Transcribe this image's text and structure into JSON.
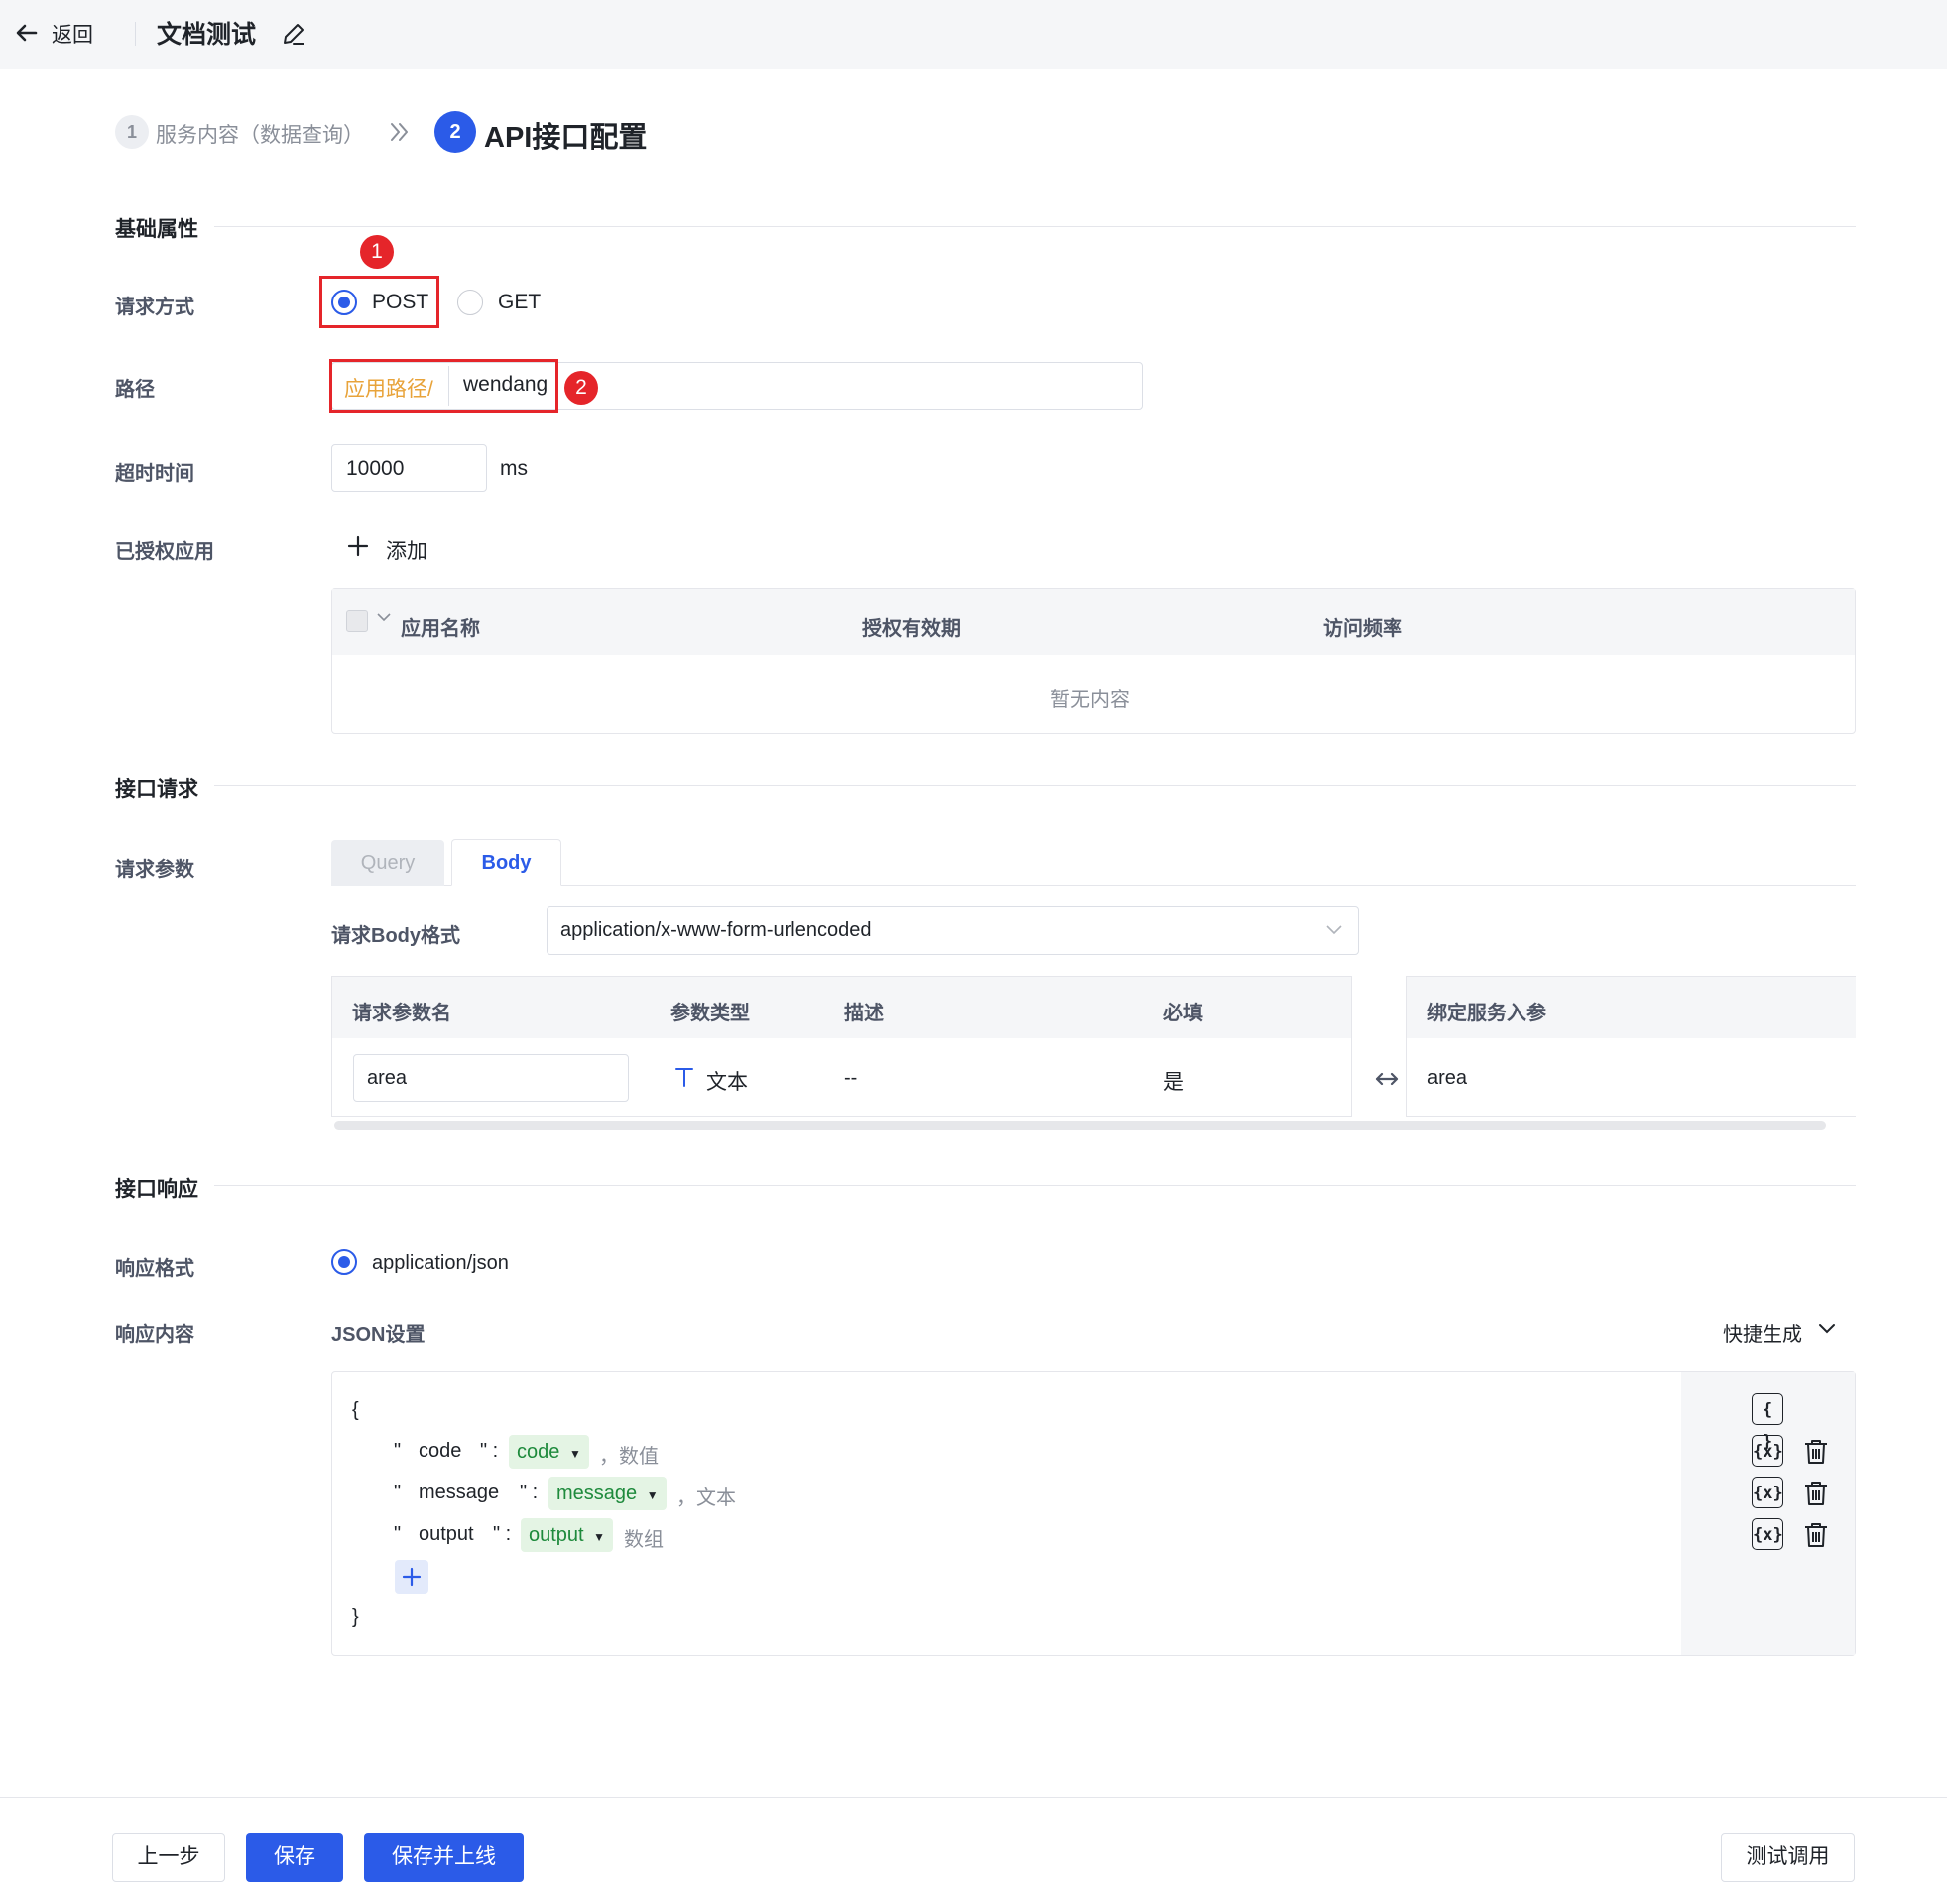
{
  "topbar": {
    "back_label": "返回",
    "title": "文档测试"
  },
  "steps": [
    {
      "number": "1",
      "label": "服务内容（数据查询）"
    },
    {
      "number": "2",
      "label": "API接口配置"
    }
  ],
  "basic": {
    "section_title": "基础属性",
    "method_label": "请求方式",
    "methods": [
      "POST",
      "GET"
    ],
    "selected_method": "POST",
    "badge1": "1",
    "path_label": "路径",
    "path_prefix": "应用路径/",
    "path_value": "wendang",
    "badge2": "2",
    "timeout_label": "超时时间",
    "timeout_value": "10000",
    "timeout_unit": "ms",
    "auth_label": "已授权应用",
    "add_label": "添加",
    "auth_table": {
      "columns": [
        "应用名称",
        "授权有效期",
        "访问频率"
      ],
      "empty_text": "暂无内容"
    }
  },
  "request": {
    "section_title": "接口请求",
    "params_label": "请求参数",
    "tabs": [
      "Query",
      "Body"
    ],
    "active_tab": "Body",
    "body_format_label": "请求Body格式",
    "body_format_value": "application/x-www-form-urlencoded",
    "params_table": {
      "columns": [
        "请求参数名",
        "参数类型",
        "描述",
        "必填"
      ],
      "bind_column": "绑定服务入参",
      "rows": [
        {
          "name": "area",
          "type": "文本",
          "desc": "--",
          "required": "是",
          "bind": "area"
        }
      ]
    }
  },
  "response": {
    "section_title": "接口响应",
    "format_label": "响应格式",
    "format_value": "application/json",
    "content_label": "响应内容",
    "json_settings_label": "JSON设置",
    "quick_generate_label": "快捷生成",
    "json_open": "{",
    "json_close": "}",
    "json_fields": [
      {
        "key": "code",
        "value": "code",
        "type": "数值",
        "sep": "，"
      },
      {
        "key": "message",
        "value": "message",
        "type": "文本",
        "sep": "，"
      },
      {
        "key": "output",
        "value": "output",
        "type": "数组",
        "sep": ""
      }
    ],
    "tool_obj": "{ }",
    "tool_var": "{x}"
  },
  "footer": {
    "prev_label": "上一步",
    "save_label": "保存",
    "save_online_label": "保存并上线",
    "test_label": "测试调用"
  },
  "colors": {
    "primary": "#2b5be8",
    "annotation": "#e5252a",
    "path_prefix": "#e8a33a",
    "tag_green": "#1e8a3c"
  }
}
